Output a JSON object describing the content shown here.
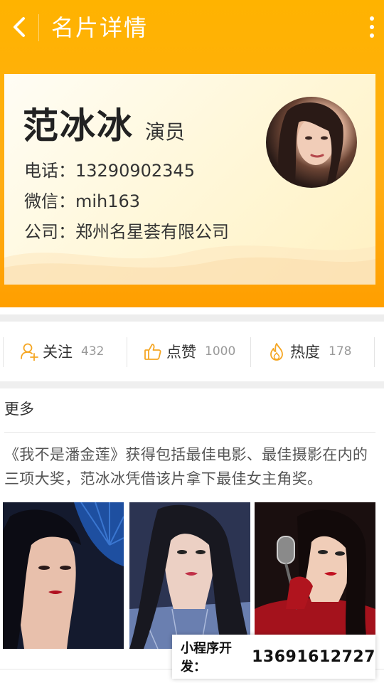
{
  "header": {
    "title": "名片详情",
    "back_icon": "chevron-left-icon",
    "more_icon": "more-vertical-icon"
  },
  "card": {
    "name": "范冰冰",
    "role": "演员",
    "phone_line": "电话：13290902345",
    "wechat_line": "微信：mih163",
    "company_line": "公司：郑州名星荟有限公司"
  },
  "stats": [
    {
      "icon": "user-add-icon",
      "label": "关注",
      "count": "432"
    },
    {
      "icon": "thumbs-up-icon",
      "label": "点赞",
      "count": "1000"
    },
    {
      "icon": "flame-icon",
      "label": "热度",
      "count": "178"
    }
  ],
  "more": {
    "title": "更多",
    "description": "《我不是潘金莲》获得包括最佳电影、最佳摄影在内的三项大奖，范冰冰凭借该片拿下最佳女主角奖。"
  },
  "promo": {
    "label": "小程序开发：",
    "number": "13691612727"
  },
  "colors": {
    "accent": "#FFB300",
    "icon": "#F5A623"
  }
}
